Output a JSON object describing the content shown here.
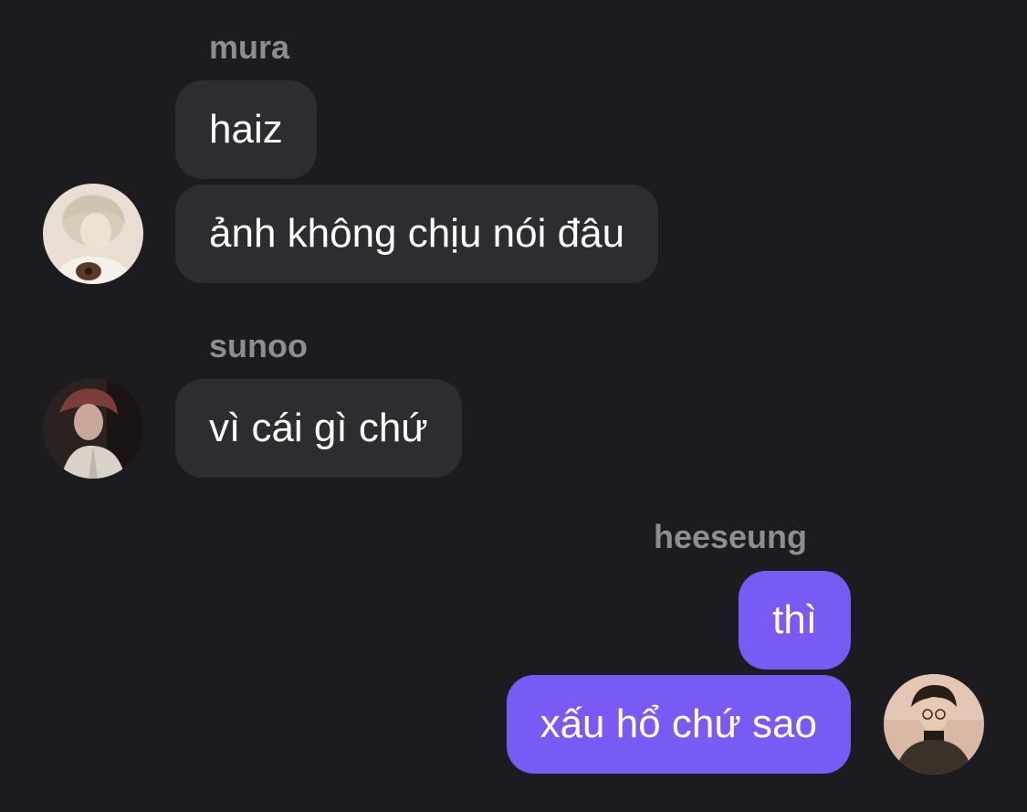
{
  "messages": [
    {
      "sender": "mura",
      "side": "left",
      "avatar": "avatar-mura",
      "bubbles": [
        "haiz",
        "ảnh không chịu nói đâu"
      ]
    },
    {
      "sender": "sunoo",
      "side": "left",
      "avatar": "avatar-sunoo",
      "bubbles": [
        "vì cái gì chứ"
      ]
    },
    {
      "sender": "heeseung",
      "side": "right",
      "avatar": "avatar-heeseung",
      "bubbles": [
        "thì",
        "xấu hổ chứ sao"
      ]
    }
  ],
  "colors": {
    "background": "#1c1b1f",
    "incoming_bubble": "#2d2c31",
    "outgoing_bubble": "#7a5af5",
    "sender_name": "#8e8d93"
  }
}
